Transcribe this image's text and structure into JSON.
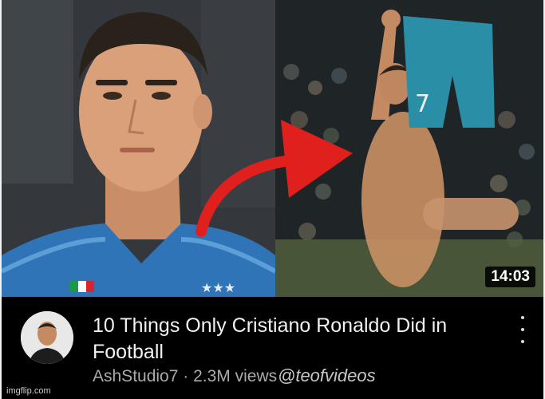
{
  "thumbnail": {
    "duration": "14:03",
    "jersey_number": "7",
    "arrow_color": "#e0201c",
    "kit_color": "#2f74b6",
    "shorts_color": "#2a8fa6"
  },
  "video": {
    "title": "10 Things Only Cristiano Ronaldo Did in Football",
    "channel": "AshStudio7",
    "views": "2.3M views"
  },
  "watermark": "@teofvideos",
  "site_watermark": "imgflip.com",
  "icons": {
    "menu": "kebab-menu-icon",
    "avatar": "channel-avatar"
  }
}
